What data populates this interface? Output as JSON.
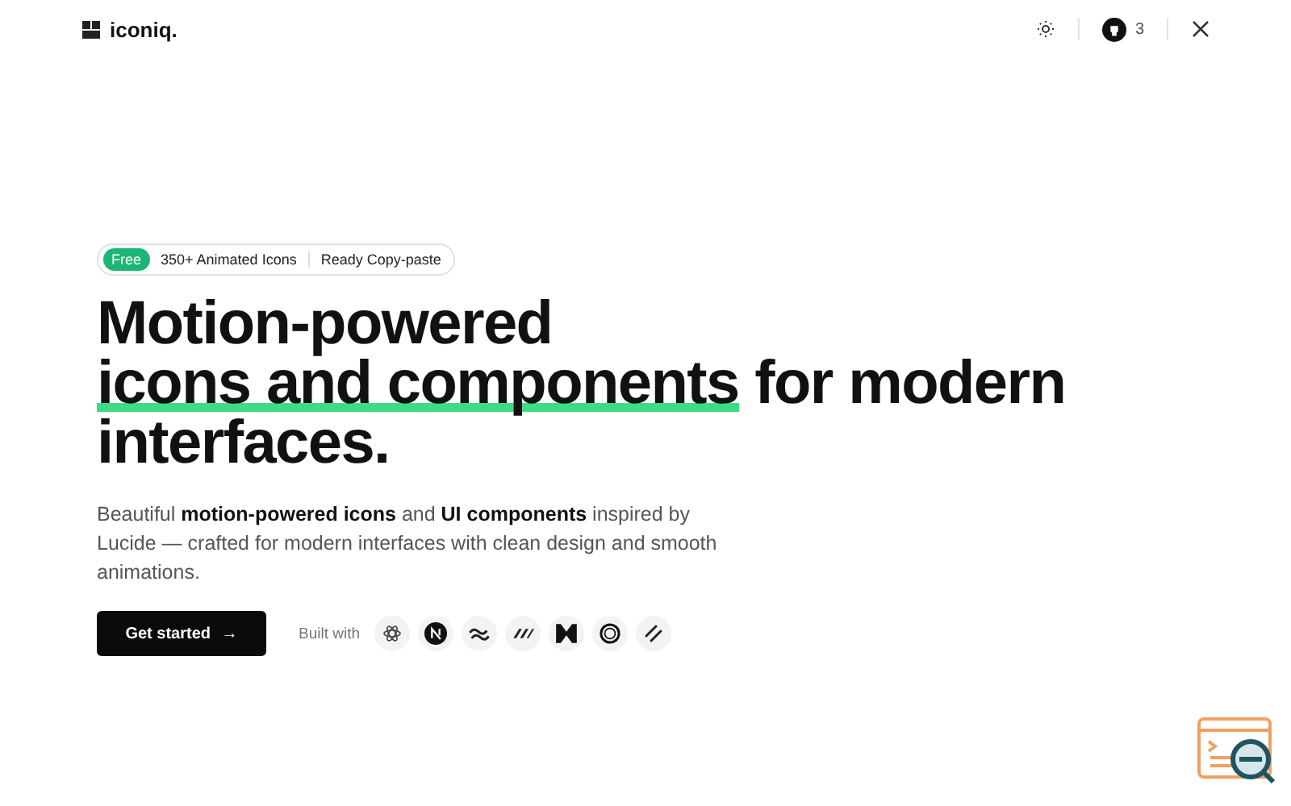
{
  "brand": {
    "name": "iconiq."
  },
  "header": {
    "github_stars": "3"
  },
  "badge": {
    "tag": "Free",
    "items": [
      "350+ Animated Icons",
      "Ready Copy-paste"
    ]
  },
  "headline": {
    "before": "Motion-powered",
    "highlight": "icons and components",
    "after": "for modern interfaces."
  },
  "description": "Beautiful **motion-powered icons** and **UI components** inspired by Lucide — crafted for modern interfaces with clean design and smooth animations.",
  "cta": {
    "label": "Get started",
    "arrow": "→"
  },
  "built_with": {
    "label": "Built with",
    "tools": [
      {
        "kind": "react"
      },
      {
        "kind": "next"
      },
      {
        "kind": "tailwind"
      },
      {
        "kind": "motion"
      },
      {
        "kind": "m"
      },
      {
        "kind": "ring"
      },
      {
        "kind": "slash"
      }
    ]
  }
}
